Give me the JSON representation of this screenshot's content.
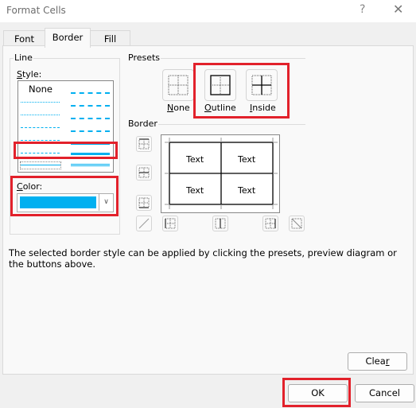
{
  "window": {
    "title": "Format Cells",
    "help_icon": "?",
    "close_icon": "✕"
  },
  "tabs": [
    {
      "label": "Font",
      "active": false
    },
    {
      "label": "Border",
      "active": true
    },
    {
      "label": "Fill",
      "active": false
    }
  ],
  "line": {
    "group_label": "Line",
    "style_label": "Style:",
    "style_label_accel": "S",
    "none_label": "None",
    "selected_style": "medium dashed (left column, row 6)",
    "color_label": "Color:",
    "color_label_accel": "C",
    "color_value": "#00b0f0"
  },
  "presets": {
    "group_label": "Presets",
    "items": [
      {
        "label": "None",
        "accel": "N"
      },
      {
        "label": "Outline",
        "accel": "O"
      },
      {
        "label": "Inside",
        "accel": "I"
      }
    ]
  },
  "border": {
    "group_label": "Border",
    "preview_cells": [
      "Text",
      "Text",
      "Text",
      "Text"
    ]
  },
  "description": "The selected border style can be applied by clicking the presets, preview diagram or the buttons above.",
  "buttons": {
    "clear": "Clear",
    "ok": "OK",
    "cancel": "Cancel"
  },
  "highlight_color": "#e2212b"
}
